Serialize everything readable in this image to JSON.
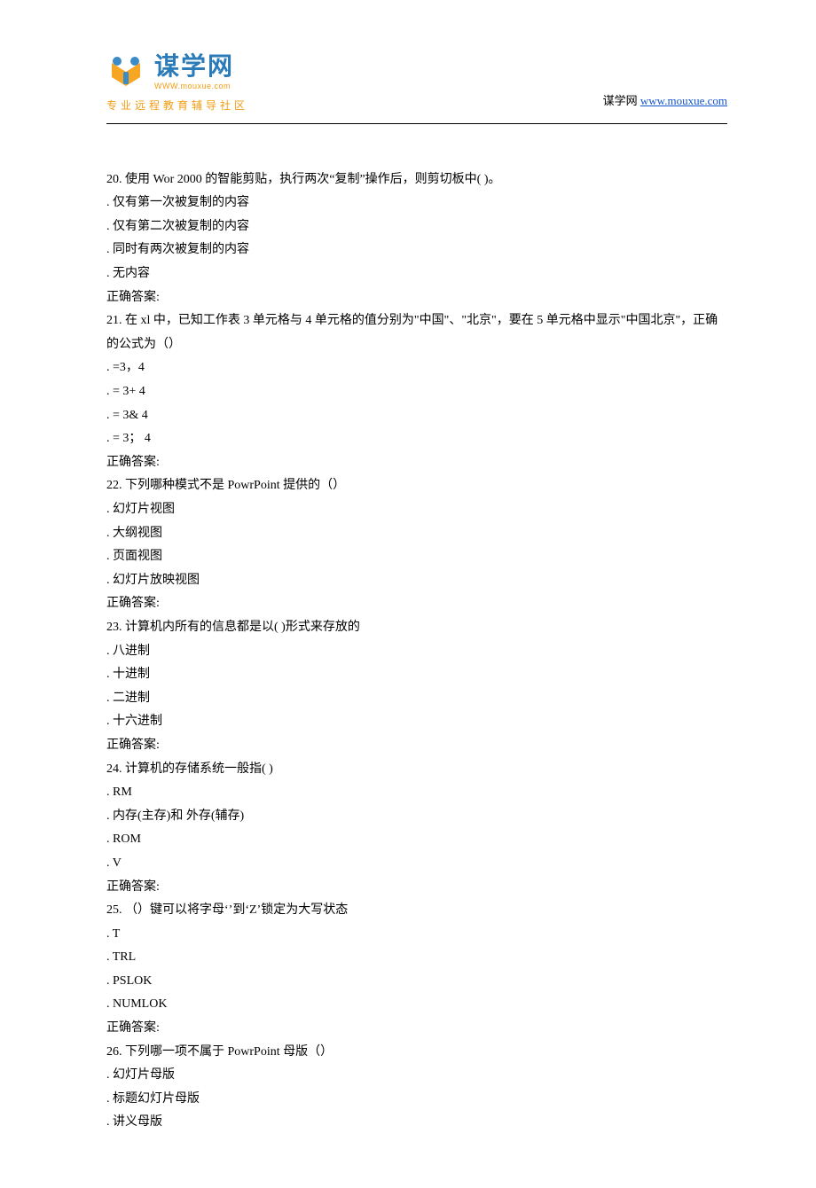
{
  "header": {
    "logo_main": "谋学网",
    "logo_url": "WWW.mouxue.com",
    "logo_sub": "专业远程教育辅导社区",
    "right_prefix": "谋学网 ",
    "right_link": "www.mouxue.com"
  },
  "questions": [
    {
      "num": "20.",
      "stem": "使用 Wor 2000 的智能剪贴，执行两次“复制”操作后，则剪切板中( )。",
      "opts": [
        ". 仅有第一次被复制的内容",
        ". 仅有第二次被复制的内容",
        ". 同时有两次被复制的内容",
        ". 无内容"
      ],
      "answer_label": "正确答案:"
    },
    {
      "num": "21.",
      "stem": "在 xl 中，已知工作表 3 单元格与 4 单元格的值分别为\"中国\"、\"北京\"，要在 5 单元格中显示\"中国北京\"，正确的公式为（）",
      "opts": [
        ".  =3，4",
        ".  =  3+  4",
        ".  = 3& 4",
        ".  = 3； 4"
      ],
      "answer_label": "正确答案:"
    },
    {
      "num": "22.",
      "stem": "下列哪种模式不是 PowrPoint 提供的（）",
      "opts": [
        ". 幻灯片视图",
        ". 大纲视图",
        ". 页面视图",
        ". 幻灯片放映视图"
      ],
      "answer_label": "正确答案:"
    },
    {
      "num": "23.",
      "stem": "计算机内所有的信息都是以( )形式来存放的",
      "opts": [
        ". 八进制",
        ". 十进制",
        ". 二进制",
        ". 十六进制"
      ],
      "answer_label": "正确答案:"
    },
    {
      "num": "24.",
      "stem": "计算机的存储系统一般指( )",
      "opts": [
        ". RM",
        ". 内存(主存)和 外存(辅存)",
        ". ROM",
        ". V"
      ],
      "answer_label": "正确答案:"
    },
    {
      "num": "25.",
      "stem": "（）键可以将字母‘’到‘Z’锁定为大写状态",
      "opts": [
        ". T",
        ". TRL",
        ". PSLOK",
        ". NUMLOK"
      ],
      "answer_label": "正确答案:"
    },
    {
      "num": "26.",
      "stem": "下列哪一项不属于 PowrPoint 母版（）",
      "opts": [
        ". 幻灯片母版",
        ". 标题幻灯片母版",
        ". 讲义母版"
      ],
      "answer_label": ""
    }
  ]
}
